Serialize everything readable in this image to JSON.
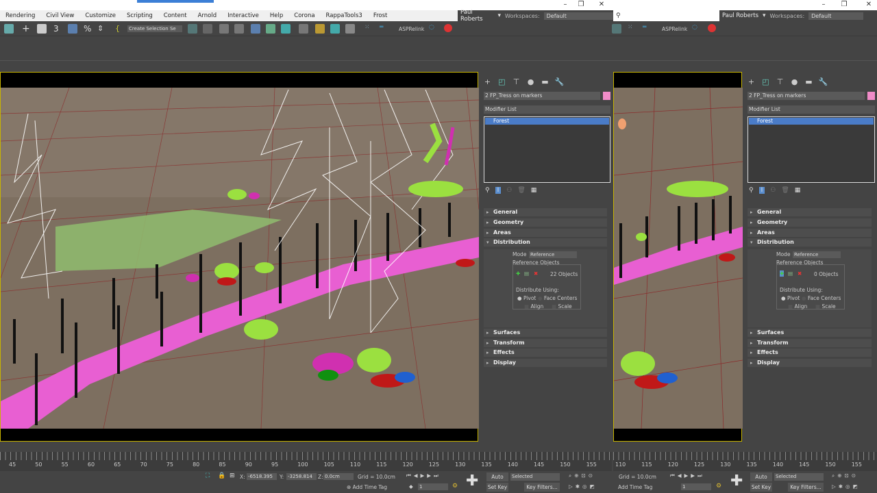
{
  "menu": [
    "Rendering",
    "Civil View",
    "Customize",
    "Scripting",
    "Content",
    "Arnold",
    "Interactive",
    "Help",
    "Corona",
    "RappaTools3",
    "Frost"
  ],
  "user": "Paul Roberts",
  "user_partial": "Roberts",
  "workspaces_label": "Workspaces:",
  "workspace": "Default",
  "selection_set": "Create Selection Se",
  "asprelink": "ASPRelink",
  "panels": [
    {
      "object_name": "2 FP_Tress on markers",
      "modifier_list": "Modifier List",
      "stack_item": "Forest",
      "rollouts": {
        "general": "General",
        "geometry": "Geometry",
        "areas": "Areas",
        "distribution": "Distribution",
        "surfaces": "Surfaces",
        "transform": "Transform",
        "effects": "Effects",
        "display": "Display"
      },
      "mode_label": "Mode",
      "mode": "Reference",
      "ref_objects": "Reference Objects",
      "count": "22 Objects",
      "distribute_using": "Distribute Using:",
      "pivot": "Pivot",
      "face_centers": "Face Centers",
      "align": "Align",
      "scale": "Scale"
    },
    {
      "object_name": "2 FP_Tress on markers",
      "modifier_list": "Modifier List",
      "stack_item": "Forest",
      "rollouts": {
        "general": "General",
        "geometry": "Geometry",
        "areas": "Areas",
        "distribution": "Distribution",
        "surfaces": "Surfaces",
        "transform": "Transform",
        "effects": "Effects",
        "display": "Display"
      },
      "mode_label": "Mode",
      "mode": "Reference",
      "ref_objects": "Reference Objects",
      "count": "0 Objects",
      "distribute_using": "Distribute Using:",
      "pivot": "Pivot",
      "face_centers": "Face Centers",
      "align": "Align",
      "scale": "Scale"
    }
  ],
  "timeline1": [
    "45",
    "50",
    "55",
    "60",
    "65",
    "70",
    "75",
    "80",
    "85",
    "90",
    "95",
    "100",
    "105",
    "110",
    "115",
    "120",
    "125",
    "130",
    "135",
    "140",
    "145",
    "150",
    "155"
  ],
  "timeline2": [
    "110",
    "115",
    "120",
    "125",
    "130",
    "135",
    "140",
    "145",
    "150",
    "155"
  ],
  "status": {
    "x_label": "X:",
    "x": "-6518.395",
    "y_label": "Y:",
    "y": "-3258.814",
    "z_label": "Z:",
    "z": "0.0cm",
    "grid": "Grid = 10.0cm",
    "add_time_tag": "Add Time Tag",
    "frame": "1",
    "auto_key": "Auto Key",
    "set_key": "Set Key",
    "selected": "Selected",
    "key_filters": "Key Filters..."
  }
}
